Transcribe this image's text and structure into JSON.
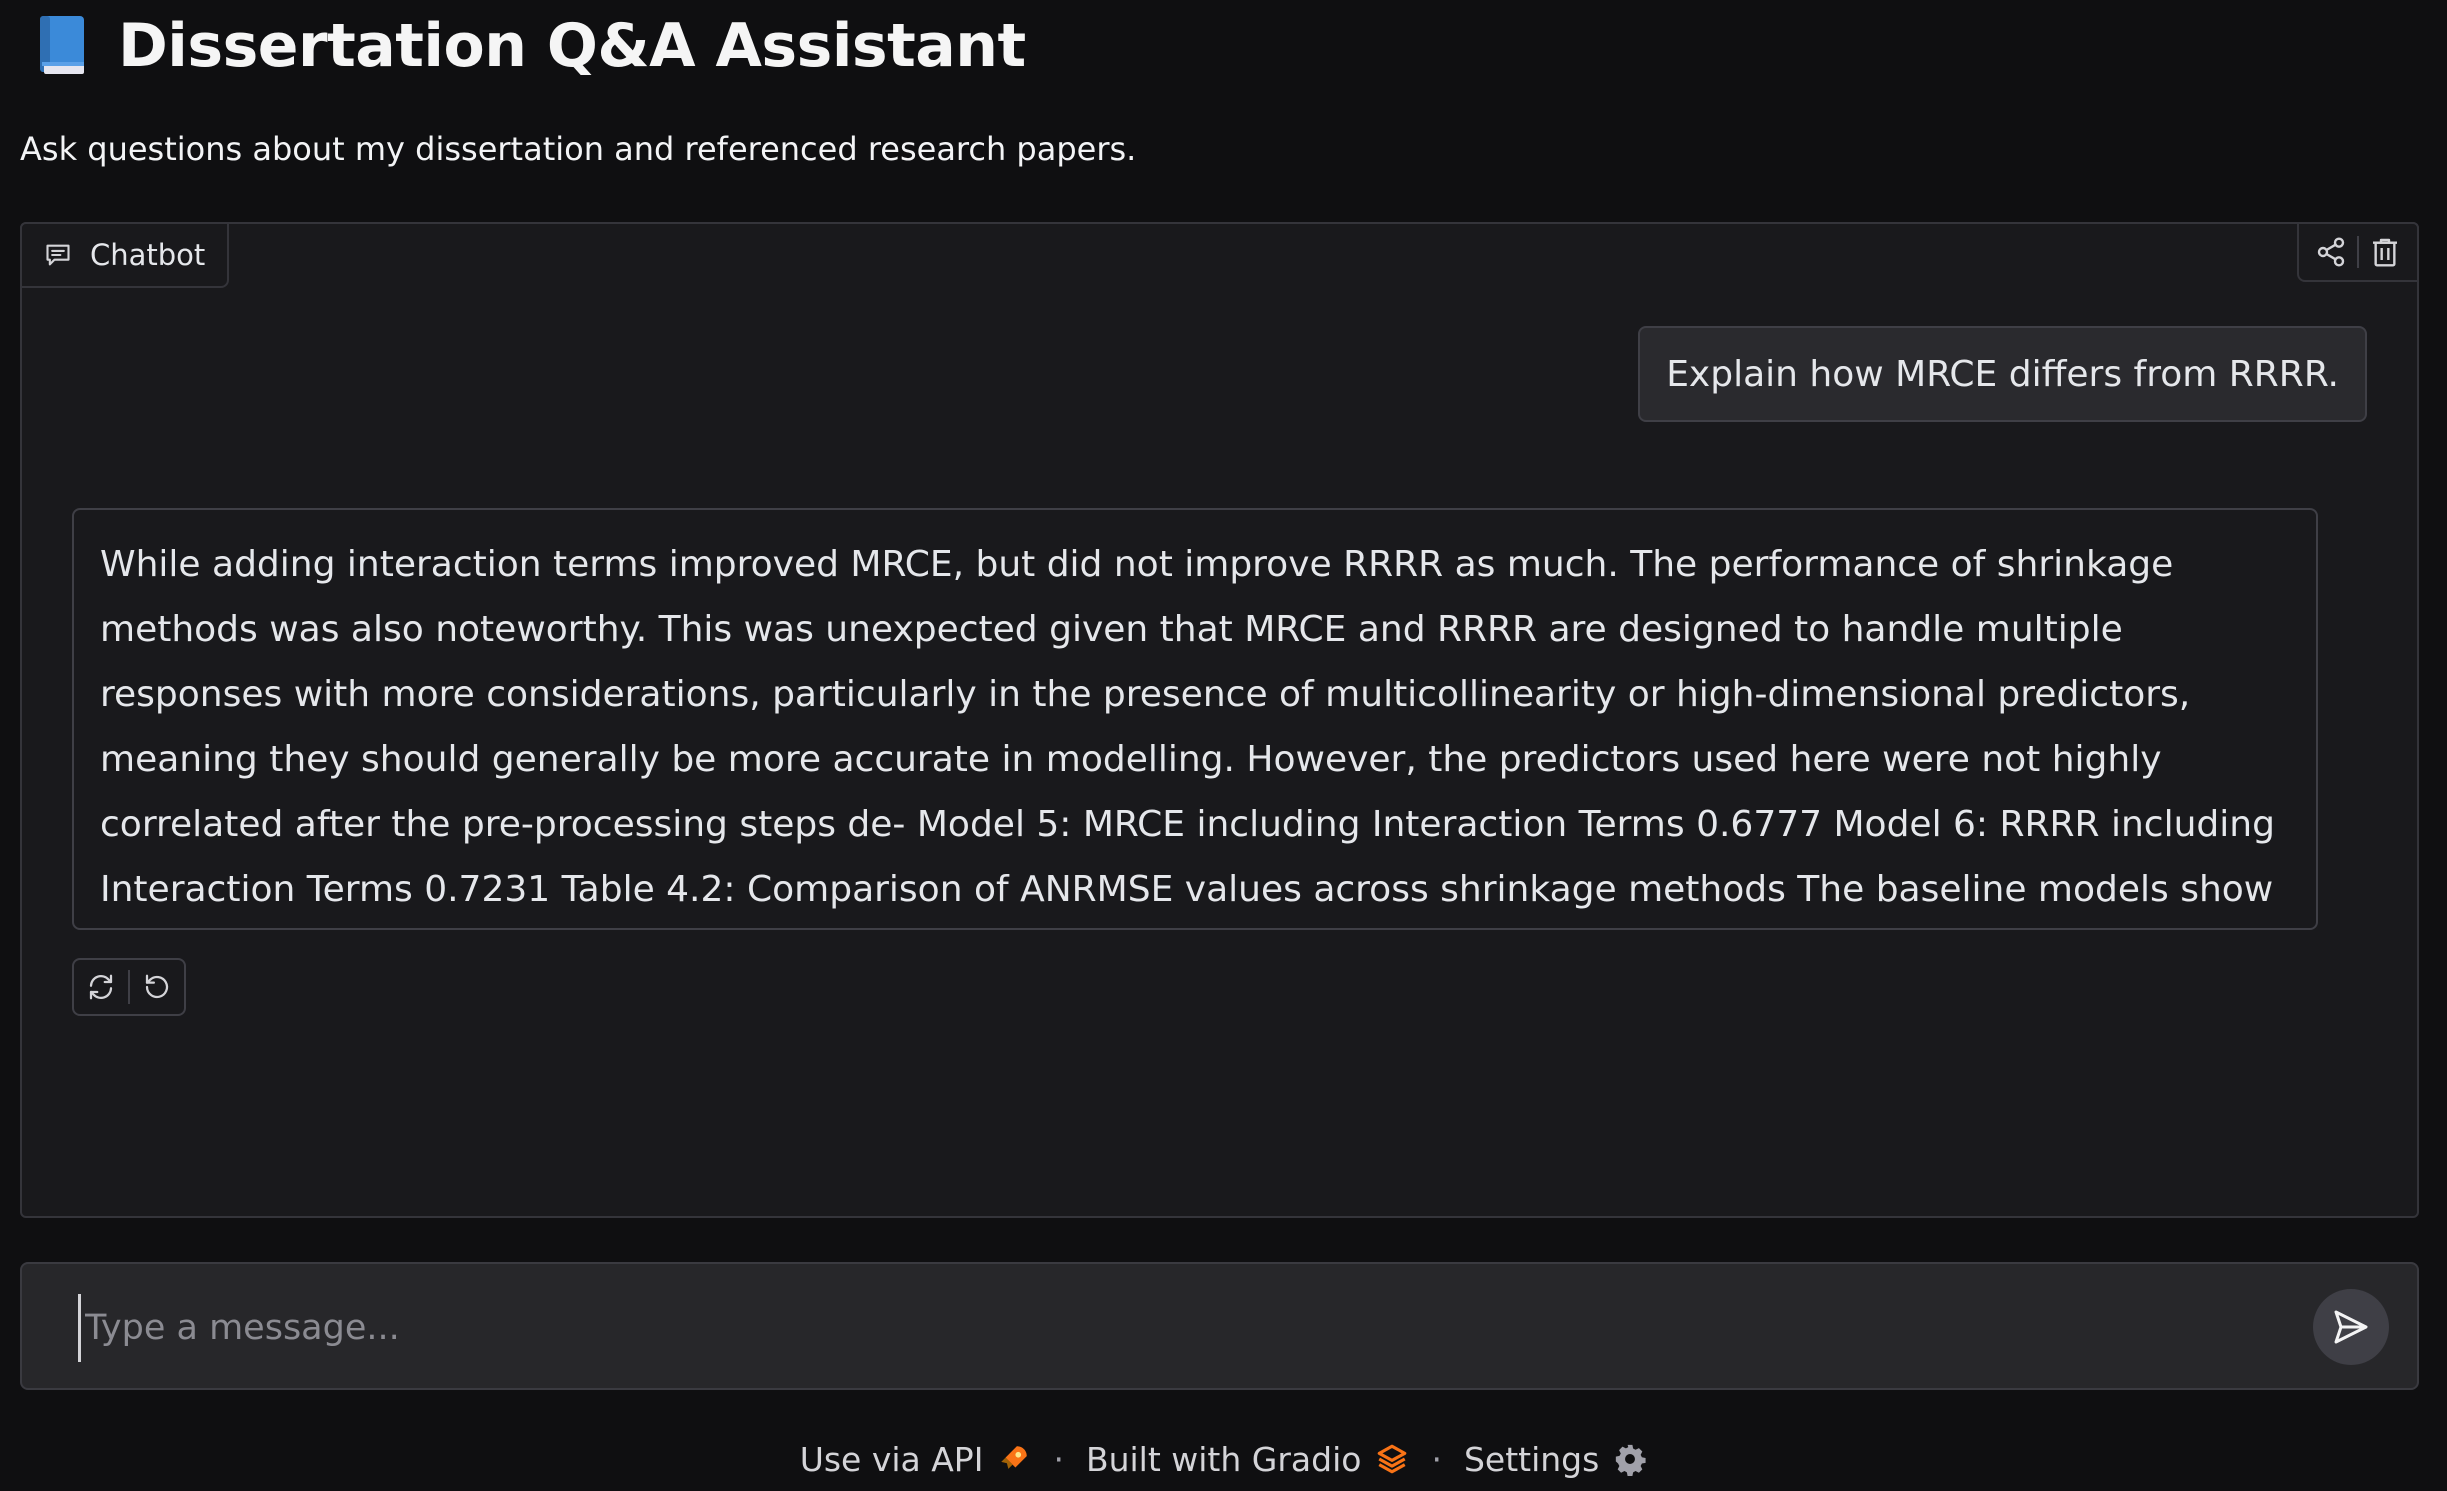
{
  "header": {
    "title": "Dissertation Q&A Assistant",
    "subtitle": "Ask questions about my dissertation and referenced research papers."
  },
  "chatbot": {
    "label": "Chatbot",
    "messages": [
      {
        "role": "user",
        "text": "Explain how MRCE differs from RRRR."
      },
      {
        "role": "assistant",
        "text": "While adding interaction terms improved MRCE, but did not improve RRRR as much. The performance of shrinkage methods was also noteworthy. This was unexpected given that MRCE and RRRR are designed to handle multiple responses with more considerations, particularly in the presence of multicollinearity or high-dimensional predictors, meaning they should generally be more accurate in modelling. However, the predictors used here were not highly correlated after the pre-processing steps de- Model 5: MRCE including Interaction Terms 0.6777 Model 6: RRRR including Interaction Terms 0.7231 Table 4.2: Comparison of ANRMSE values across shrinkage methods The baseline models show that RR"
      }
    ]
  },
  "input": {
    "placeholder": "Type a message..."
  },
  "footer": {
    "api_label": "Use via API",
    "separator": "·",
    "built_label": "Built with Gradio",
    "settings_label": "Settings"
  },
  "icons": {
    "title": "book-icon",
    "chatbot": "chat-bubble-icon",
    "share": "share-icon",
    "clear": "trash-icon",
    "retry": "retry-icon",
    "undo": "undo-icon",
    "send": "send-icon",
    "api": "rocket-icon",
    "gradio": "gradio-logo-icon",
    "settings": "gear-icon"
  },
  "colors": {
    "background": "#0f0f11",
    "panel": "#19191c",
    "border": "#34343a",
    "gradio_orange": "#f97316"
  }
}
